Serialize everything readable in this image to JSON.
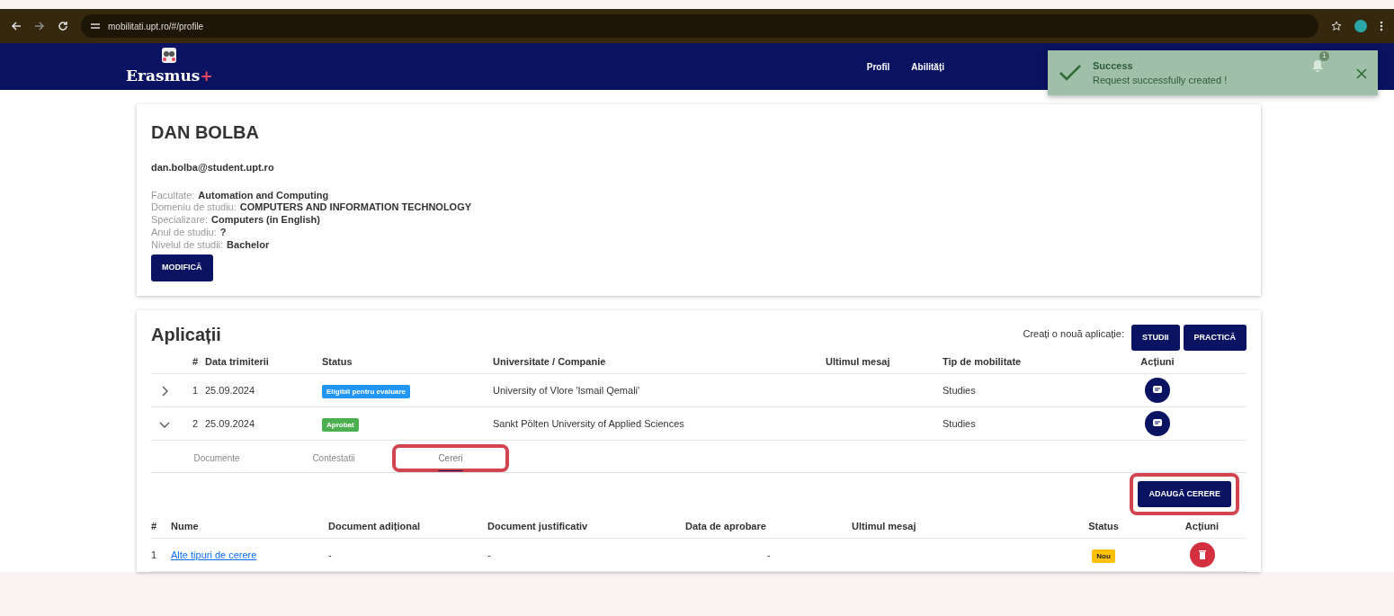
{
  "browser": {
    "url": "mobilitati.upt.ro/#/profile"
  },
  "navbar": {
    "logo": "Erasmus",
    "logo_plus": "+",
    "items": [
      {
        "label": "Profil"
      },
      {
        "label": "Abilități"
      }
    ],
    "notifications": "1"
  },
  "toast": {
    "title": "Success",
    "message": "Request successfully created !"
  },
  "profile": {
    "name": "DAN BOLBA",
    "email": "dan.bolba@student.upt.ro",
    "fields": [
      {
        "label": "Facultate:",
        "value": "Automation and Computing"
      },
      {
        "label": "Domeniu de studiu:",
        "value": "COMPUTERS AND INFORMATION TECHNOLOGY"
      },
      {
        "label": "Specializare:",
        "value": "Computers (in English)"
      },
      {
        "label": "Anul de studiu:",
        "value": "?"
      },
      {
        "label": "Nivelul de studii:",
        "value": "Bachelor"
      }
    ],
    "edit_button": "MODIFICĂ"
  },
  "applications": {
    "title": "Aplicații",
    "create_label": "Creați o nouă aplicație:",
    "create_buttons": [
      "STUDII",
      "PRACTICĂ"
    ],
    "columns": [
      "#",
      "Data trimiterii",
      "Status",
      "Universitate / Companie",
      "Ultimul mesaj",
      "Tip de mobilitate",
      "Acțiuni"
    ],
    "rows": [
      {
        "expanded": false,
        "index": "1",
        "date": "25.09.2024",
        "status": "Eligibil pentru evaluare",
        "color": "#2196f3",
        "university": "University of Vlore 'Ismail Qemali'",
        "last_message": "",
        "type": "Studies"
      },
      {
        "expanded": true,
        "index": "2",
        "date": "25.09.2024",
        "status": "Aprobat",
        "color": "#4caf50",
        "university": "Sankt Pölten University of Applied Sciences",
        "last_message": "",
        "type": "Studies"
      }
    ],
    "tabs": [
      {
        "label": "Documente",
        "selected": false,
        "annotated": false
      },
      {
        "label": "Contestatii",
        "selected": false,
        "annotated": false
      },
      {
        "label": "Cereri",
        "selected": true,
        "annotated": true
      }
    ],
    "add_button": {
      "label": "ADAUGĂ CERERE",
      "annotated": true
    },
    "requests": {
      "columns": [
        "#",
        "Nume",
        "Document adițional",
        "Document justificativ",
        "Data de aprobare",
        "Ultimul mesaj",
        "Status",
        "Acțiuni"
      ],
      "rows": [
        {
          "index": "1",
          "name": "Alte tipuri de cerere",
          "extra_doc": "-",
          "justif_doc": "-",
          "approval_date": "-",
          "last_message": "",
          "status": "Nou",
          "color": "#ffc107"
        }
      ]
    }
  }
}
